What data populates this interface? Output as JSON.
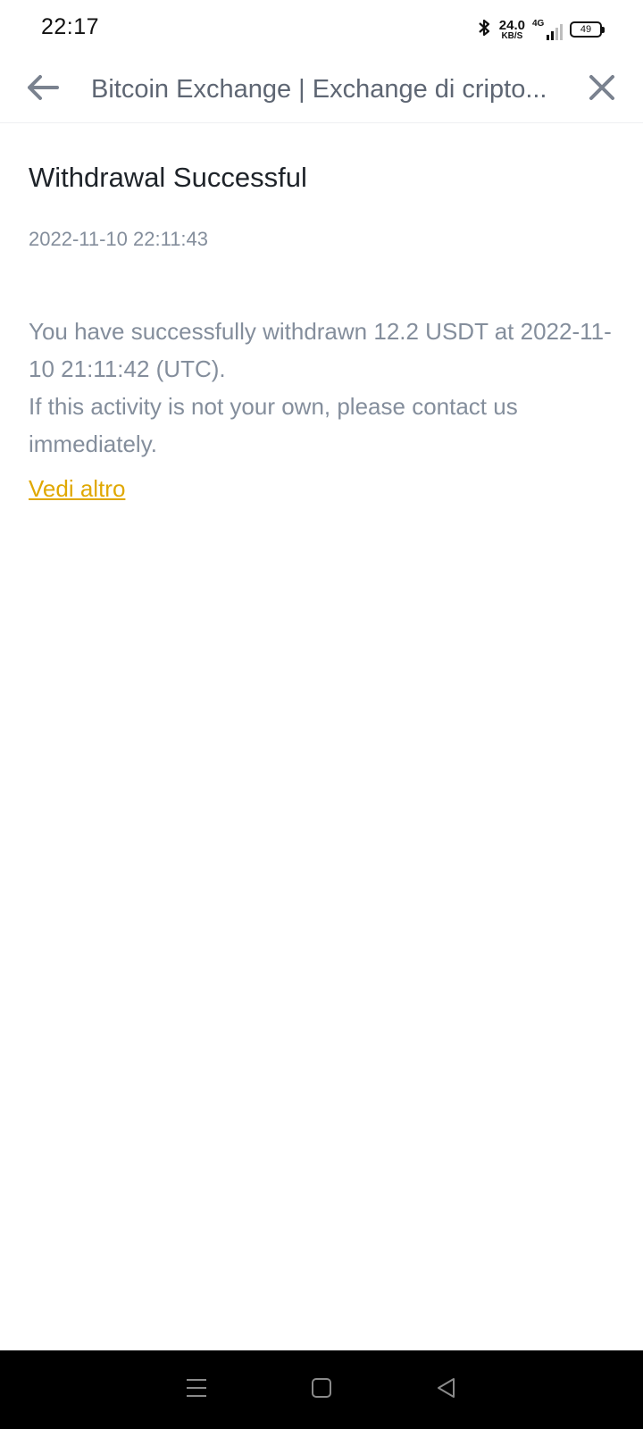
{
  "status_bar": {
    "time": "22:17",
    "net_speed_value": "24.0",
    "net_speed_unit": "KB/S",
    "network_type": "4G",
    "battery_level": "49"
  },
  "app_bar": {
    "title": "Bitcoin Exchange | Exchange di cripto..."
  },
  "notice": {
    "title": "Withdrawal Successful",
    "date": "2022-11-10 22:11:43",
    "body_line1": "You have successfully withdrawn 12.2 USDT at 2022-11-10 21:11:42 (UTC).",
    "body_line2": "If this activity is not your own, please contact us immediately.",
    "more_link": "Vedi altro"
  },
  "colors": {
    "link": "#e0a800",
    "body_text": "#848e9c",
    "title_text": "#1e2329"
  },
  "icons": [
    "back-arrow-icon",
    "close-icon",
    "bluetooth-icon",
    "signal-icon",
    "battery-icon",
    "menu-icon",
    "home-icon",
    "back-triangle-icon"
  ]
}
